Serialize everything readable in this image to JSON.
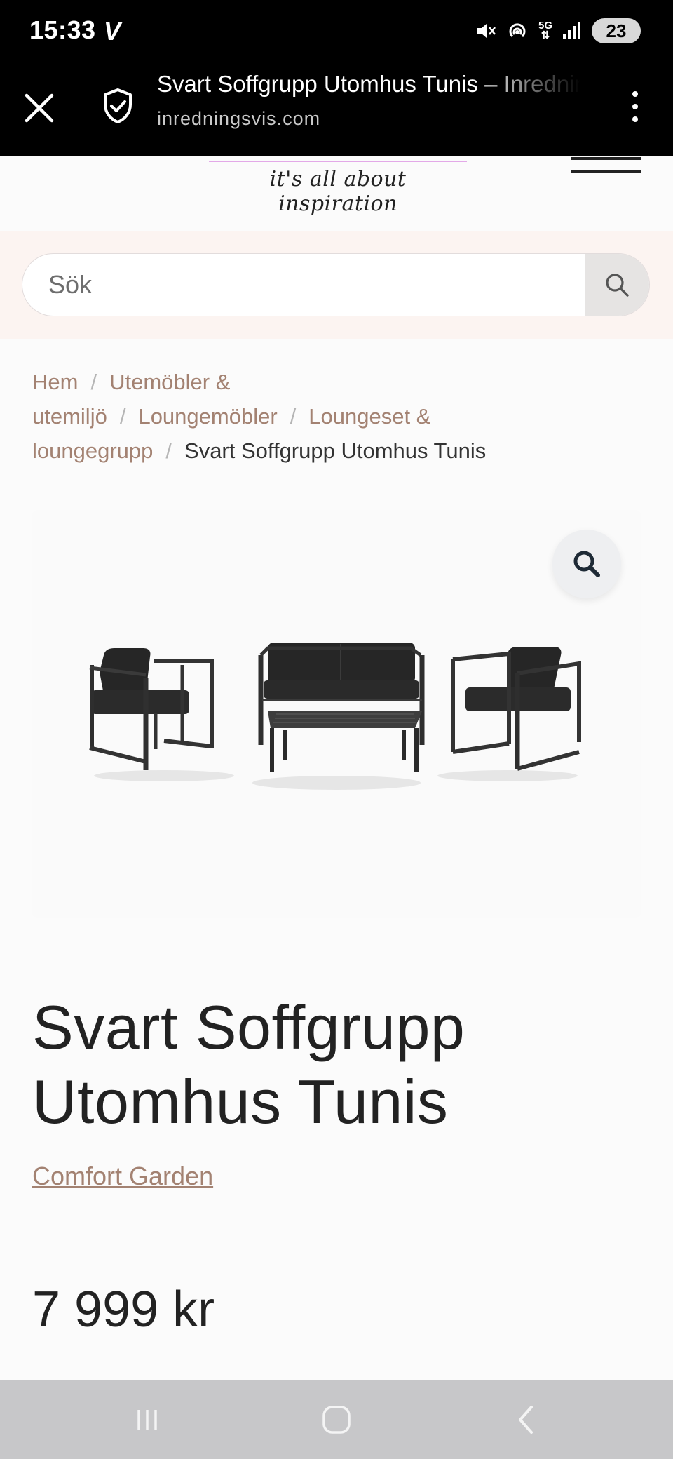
{
  "status_bar": {
    "time": "15:33",
    "app_icon_letter": "V",
    "network": "5G",
    "battery": "23"
  },
  "browser": {
    "page_title": "Svart Soffgrupp Utomhus Tunis – Inredningsvis",
    "url": "inredningsvis.com"
  },
  "site": {
    "tagline": "it's all about inspiration"
  },
  "search": {
    "placeholder": "Sök"
  },
  "breadcrumb": {
    "items": [
      "Hem",
      "Utemöbler & utemiljö",
      "Loungemöbler",
      "Loungeset & loungegrupp"
    ],
    "separator": "/",
    "current": "Svart Soffgrupp Utomhus Tunis"
  },
  "product": {
    "title": "Svart Soffgrupp Utomhus Tunis",
    "brand": "Comfort Garden",
    "price": "7 999 kr"
  },
  "colors": {
    "accent_link": "#a38272",
    "search_band": "#fcf4f1",
    "toolbar": "#000000"
  },
  "icons": [
    "close-icon",
    "shield-check-icon",
    "more-vert-icon",
    "search-icon",
    "zoom-icon",
    "hamburger-icon",
    "recents-icon",
    "home-icon",
    "back-icon"
  ]
}
